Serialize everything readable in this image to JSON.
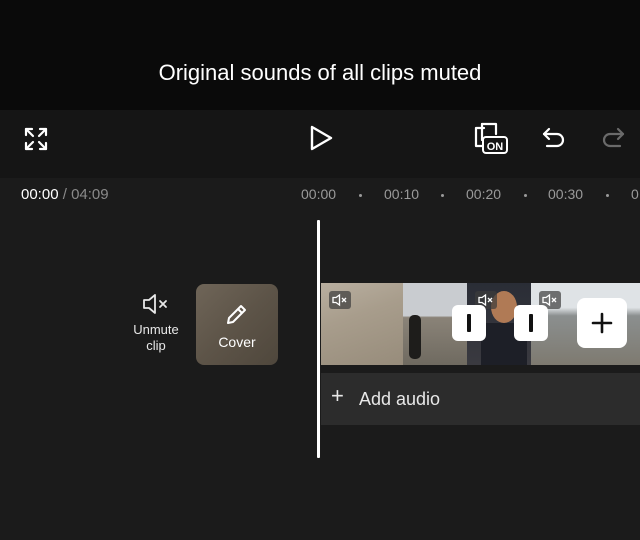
{
  "preview": {
    "toast": "Original sounds of all clips muted"
  },
  "controls": {
    "fullscreen_icon": "expand-icon",
    "play_icon": "play-icon",
    "caption_toggle_badge": "ON",
    "undo_icon": "undo-icon",
    "redo_icon": "redo-icon"
  },
  "timeline": {
    "current_time": "00:00",
    "separator": "/",
    "total_time": "04:09",
    "ruler_ticks": [
      "00:00",
      "00:10",
      "00:20",
      "00:30",
      "0"
    ],
    "unmute_label_line1": "Unmute",
    "unmute_label_line2": "clip",
    "cover_label": "Cover",
    "add_audio_label": "Add audio",
    "add_audio_plus": "+"
  },
  "colors": {
    "background": "#1b1b1b",
    "preview_bg": "#0a0a0a",
    "controls_bg": "#151515",
    "audio_row_bg": "#2c2c2c",
    "playhead": "#ffffff"
  }
}
